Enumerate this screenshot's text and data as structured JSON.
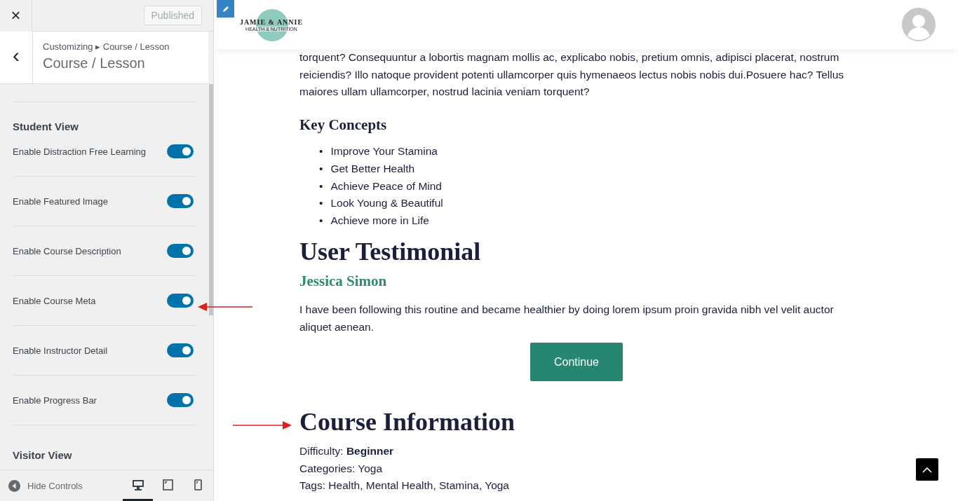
{
  "customizer": {
    "close": "×",
    "publish_button": {
      "label": "Published",
      "disabled": true
    },
    "back": "‹",
    "breadcrumb": "Customizing ▸ Course / Lesson",
    "title": "Course / Lesson",
    "sections": [
      {
        "heading": "Student View",
        "toggles": [
          {
            "label": "Enable Distraction Free Learning",
            "on": true
          },
          {
            "label": "Enable Featured Image",
            "on": true
          },
          {
            "label": "Enable Course Description",
            "on": true
          },
          {
            "label": "Enable Course Meta",
            "on": true
          },
          {
            "label": "Enable Instructor Detail",
            "on": true
          },
          {
            "label": "Enable Progress Bar",
            "on": true
          }
        ]
      },
      {
        "heading": "Visitor View"
      }
    ],
    "footer": {
      "hide_controls": "Hide Controls",
      "devices": [
        {
          "kind": "desktop",
          "selected": true
        },
        {
          "kind": "tablet",
          "selected": false
        },
        {
          "kind": "mobile",
          "selected": false
        }
      ]
    }
  },
  "preview": {
    "logo": {
      "name": "JAMIE & ANNIE",
      "tagline": "HEALTH & NUTRITION"
    },
    "intro": "torquent? Consequuntur a lobortis magnam mollis ac, explicabo nobis, pretium omnis, adipisci placerat, nostrum reiciendis? Illo natoque provident potenti ullamcorper quis hymenaeos lectus nobis nobis dui.Posuere hac? Tellus maiores ullam ullamcorper, nostrud lacinia veniam torquent?",
    "key_concepts": {
      "heading": "Key Concepts",
      "marker": "•",
      "items": [
        "Improve Your Stamina",
        "Get Better Health",
        "Achieve Peace of Mind",
        "Look Young & Beautiful",
        "Achieve more in Life"
      ]
    },
    "testimonial": {
      "heading": "User Testimonial",
      "name": "Jessica Simon",
      "quote": "I have been following this routine and became healthier by doing lorem ipsum proin gravida nibh vel velit auctor aliquet aenean.",
      "button": "Continue"
    },
    "course_info": {
      "heading": "Course Information",
      "lines": [
        {
          "label": "Difficulty:",
          "value": "Beginner",
          "bold": true
        },
        {
          "label": "Categories:",
          "value": "Yoga",
          "bold": false
        },
        {
          "label": "Tags:",
          "value": "Health, Mental Health, Stamina, Yoga",
          "bold": false
        }
      ]
    }
  }
}
